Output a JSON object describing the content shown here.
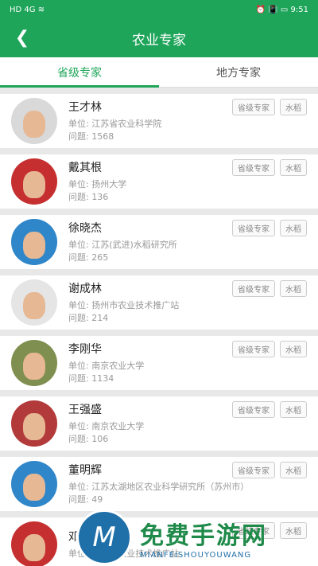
{
  "status": {
    "left": "HD 4G ≋",
    "right": "⏰ 📳 ▭ 9:51"
  },
  "appbar": {
    "title": "农业专家"
  },
  "tabs": [
    {
      "label": "省级专家",
      "active": true
    },
    {
      "label": "地方专家",
      "active": false
    }
  ],
  "experts": [
    {
      "name": "王才林",
      "unit": "单位: 江苏省农业科学院",
      "questions": "问题: 1568",
      "tag1": "省级专家",
      "tag2": "水稻",
      "avatar_bg": "#d9d9d9"
    },
    {
      "name": "戴其根",
      "unit": "单位: 扬州大学",
      "questions": "问题: 136",
      "tag1": "省级专家",
      "tag2": "水稻",
      "avatar_bg": "#c62f2f"
    },
    {
      "name": "徐晓杰",
      "unit": "单位: 江苏(武进)水稻研究所",
      "questions": "问题: 265",
      "tag1": "省级专家",
      "tag2": "水稻",
      "avatar_bg": "#2f86c9"
    },
    {
      "name": "谢成林",
      "unit": "单位: 扬州市农业技术推广站",
      "questions": "问题: 214",
      "tag1": "省级专家",
      "tag2": "水稻",
      "avatar_bg": "#e5e5e5"
    },
    {
      "name": "李刚华",
      "unit": "单位: 南京农业大学",
      "questions": "问题: 1134",
      "tag1": "省级专家",
      "tag2": "水稻",
      "avatar_bg": "#7f8f4f"
    },
    {
      "name": "王强盛",
      "unit": "单位: 南京农业大学",
      "questions": "问题: 106",
      "tag1": "省级专家",
      "tag2": "水稻",
      "avatar_bg": "#b23a3a"
    },
    {
      "name": "董明辉",
      "unit": "单位: 江苏太湖地区农业科学研究所（苏州市）",
      "questions": "问题: 49",
      "tag1": "省级专家",
      "tag2": "水稻",
      "avatar_bg": "#2f86c9"
    },
    {
      "name": "邓建",
      "unit": "单位: 扬州市农业技术推广站",
      "questions": "",
      "tag1": "省级专家",
      "tag2": "水稻",
      "avatar_bg": "#c62f2f"
    }
  ],
  "watermark": {
    "logo": "M",
    "big": "免费手游网",
    "small": "MIANFEISHOUYOUWANG"
  }
}
